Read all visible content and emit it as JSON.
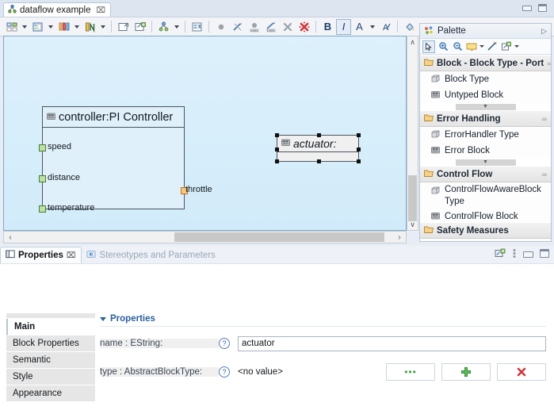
{
  "window": {
    "minimize_label": "Minimize",
    "maximize_label": "Maximize"
  },
  "editor": {
    "tab": {
      "label": "dataflow example",
      "close": "⌧",
      "icon": "diagram-icon"
    },
    "toolbar": {
      "groups": [
        {
          "name": "block-tool",
          "icon": "block-icon",
          "has_dropdown": true
        },
        {
          "name": "block-instance-tool",
          "icon": "block-instance-icon",
          "has_dropdown": true
        },
        {
          "name": "port-tool",
          "icon": "port-icon",
          "has_dropdown": true
        },
        {
          "name": "connection-tool",
          "icon": "connection-icon",
          "has_dropdown": true
        }
      ],
      "arrange": [
        {
          "name": "open-diagram",
          "icon": "open-diagram-icon"
        },
        {
          "name": "new-diagram",
          "icon": "new-diagram-icon"
        }
      ],
      "layout": [
        {
          "name": "layout-tool",
          "icon": "layout-icon",
          "has_dropdown": true
        }
      ],
      "view": [
        {
          "name": "view-tool",
          "icon": "view-icon"
        }
      ],
      "marks": [
        {
          "name": "show-node",
          "icon": "dot-icon"
        },
        {
          "name": "hide-connection",
          "icon": "hide-connection-icon"
        },
        {
          "name": "show-label",
          "icon": "show-label-icon"
        },
        {
          "name": "hide-label",
          "icon": "hide-label-icon"
        },
        {
          "name": "delete-element",
          "icon": "delete-icon"
        },
        {
          "name": "delete-all",
          "icon": "delete-all-icon"
        }
      ],
      "format": [
        {
          "name": "bold",
          "label": "B",
          "active": false
        },
        {
          "name": "italic",
          "label": "I",
          "active": true
        },
        {
          "name": "font-color",
          "label": "A",
          "has_dropdown": true
        },
        {
          "name": "font-style",
          "icon": "font-style-icon"
        },
        {
          "name": "fill-color",
          "icon": "fill-color-icon",
          "has_dropdown": true
        }
      ]
    },
    "canvas": {
      "blocks": [
        {
          "id": "controller",
          "title": "controller:PI Controller",
          "icon": "untyped-block-icon",
          "selected": false,
          "ports": [
            {
              "name": "speed",
              "kind": "in"
            },
            {
              "name": "distance",
              "kind": "in"
            },
            {
              "name": "temperature",
              "kind": "in"
            },
            {
              "name": "throttle",
              "kind": "out"
            }
          ]
        },
        {
          "id": "actuator",
          "title": "actuator:",
          "icon": "untyped-block-icon",
          "selected": true,
          "ports": []
        }
      ],
      "scroll": {
        "left_arrow": "‹",
        "right_arrow": "›",
        "up_arrow": "∧",
        "down_arrow": "∨"
      }
    }
  },
  "palette": {
    "title": "Palette",
    "collapse_glyph": "▷",
    "tools": [
      {
        "name": "select-tool",
        "icon": "arrow-icon",
        "selected": true
      },
      {
        "name": "zoom-in-tool",
        "icon": "zoom-in-icon"
      },
      {
        "name": "zoom-out-tool",
        "icon": "zoom-out-icon"
      },
      {
        "name": "note-tool",
        "icon": "note-icon",
        "has_dropdown": true
      },
      {
        "name": "connection-tool",
        "icon": "connection-line-icon"
      },
      {
        "name": "link-tool",
        "icon": "link-icon",
        "has_dropdown": true
      }
    ],
    "drawers": [
      {
        "title": "Block - Block Type - Port",
        "pin": "∞",
        "items": [
          {
            "label": "Block Type",
            "icon": "block-type-icon"
          },
          {
            "label": "Untyped Block",
            "icon": "untyped-block-icon"
          }
        ],
        "has_more": true
      },
      {
        "title": "Error Handling",
        "pin": "∞",
        "items": [
          {
            "label": "ErrorHandler Type",
            "icon": "block-type-icon"
          },
          {
            "label": "Error Block",
            "icon": "untyped-block-icon"
          }
        ],
        "has_more": true
      },
      {
        "title": "Control Flow",
        "pin": "∞",
        "items": [
          {
            "label": "ControlFlowAwareBlock Type",
            "icon": "block-type-icon"
          },
          {
            "label": "ControlFlow Block",
            "icon": "untyped-block-icon"
          }
        ],
        "has_more": false
      },
      {
        "title": "Safety Measures",
        "pin": "",
        "items": [],
        "has_more": false
      }
    ]
  },
  "properties_view": {
    "tabs": [
      {
        "label": "Properties",
        "icon": "properties-icon",
        "active": true,
        "close": "⌧"
      },
      {
        "label": "Stereotypes and Parameters",
        "icon": "stereotype-icon",
        "active": false
      }
    ],
    "view_buttons": [
      {
        "name": "new-view",
        "icon": "new-view-icon"
      },
      {
        "name": "view-menu",
        "icon": "view-menu-icon"
      },
      {
        "name": "minimize-view",
        "icon": "minimize-icon"
      },
      {
        "name": "maximize-view",
        "icon": "maximize-icon"
      }
    ],
    "side_tabs": [
      {
        "label": "Main",
        "active": true
      },
      {
        "label": "Block Properties",
        "active": false
      },
      {
        "label": "Semantic",
        "active": false
      },
      {
        "label": "Style",
        "active": false
      },
      {
        "label": "Appearance",
        "active": false
      }
    ],
    "section_title": "Properties",
    "fields": [
      {
        "label": "name : EString:",
        "help": "?",
        "type": "text",
        "value": "actuator",
        "placeholder": ""
      },
      {
        "label": "type : AbstractBlockType:",
        "help": "?",
        "type": "reference",
        "value": "<no value>",
        "buttons": [
          {
            "name": "browse-button",
            "label": "•••"
          },
          {
            "name": "add-button",
            "label": "+"
          },
          {
            "name": "delete-button",
            "label": "✖"
          }
        ]
      }
    ]
  },
  "colors": {
    "canvas_bg": "#d8eefb",
    "block_fill": "#dff0fb",
    "port_in": "#bde0a4",
    "port_out": "#fbc87a",
    "accent": "#2b5f9e",
    "delete": "#d0383e",
    "add": "#3fa043"
  }
}
